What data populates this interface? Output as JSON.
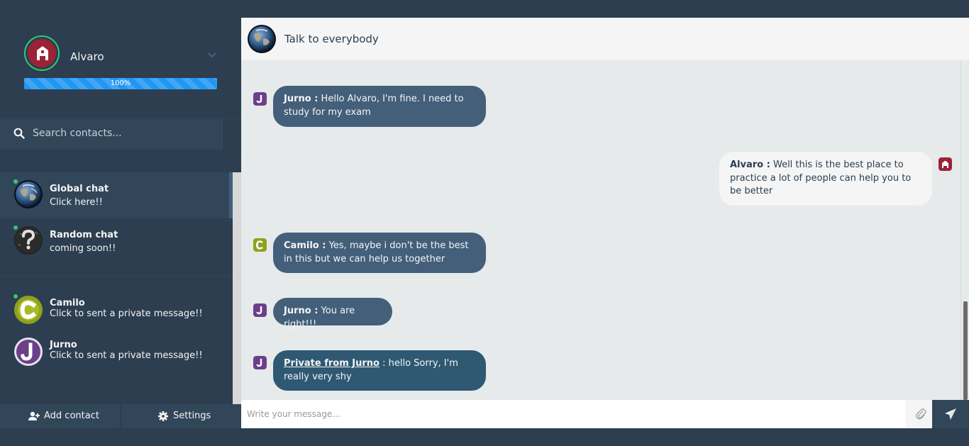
{
  "profile": {
    "name": "Alvaro",
    "progress_label": "100%",
    "progress_fraction": 1.0
  },
  "search": {
    "placeholder": "Search contacts..."
  },
  "contacts": [
    {
      "name": "Global chat",
      "preview": "Click here!!",
      "avatar": "earth-avatar",
      "online": true,
      "active": true
    },
    {
      "name": "Random chat",
      "preview": "coming soon!!",
      "avatar": "question-avatar",
      "online": true,
      "active": false
    },
    {
      "name": "Camilo",
      "preview": "Click to sent a private message!!",
      "avatar": "letter-c-avatar",
      "online": true,
      "active": false
    },
    {
      "name": "Jurno",
      "preview": "Click to sent a private message!!",
      "avatar": "letter-j-avatar",
      "online": false,
      "active": false
    }
  ],
  "bottom": {
    "add_contact": "Add contact",
    "settings": "Settings"
  },
  "header": {
    "title": "Talk to everybody"
  },
  "messages": [
    {
      "author": "Jurno :",
      "text": " Hello Alvaro, I'm fine. I need to study for my exam",
      "side": "left"
    },
    {
      "author": "Alvaro :",
      "text": " Well this is the best place to practice a lot of people can help you to be better",
      "side": "right"
    },
    {
      "author": "Camilo :",
      "text": " Yes, maybe i don't be the best in this but we can help us together",
      "side": "left"
    },
    {
      "author": "Jurno :",
      "text": " You are right!!!",
      "side": "left"
    },
    {
      "author": "Private from Jurno",
      "text": " : hello Sorry, I'm really very shy",
      "side": "left",
      "private": true
    }
  ],
  "composer": {
    "placeholder": "Write your message..."
  },
  "colors": {
    "sidebar": "#2c3e50",
    "online": "#2ecc71",
    "bubble_sent": "#435f7a",
    "bubble_reply": "#f5f5f5",
    "chat_bg": "#e6eaea"
  }
}
